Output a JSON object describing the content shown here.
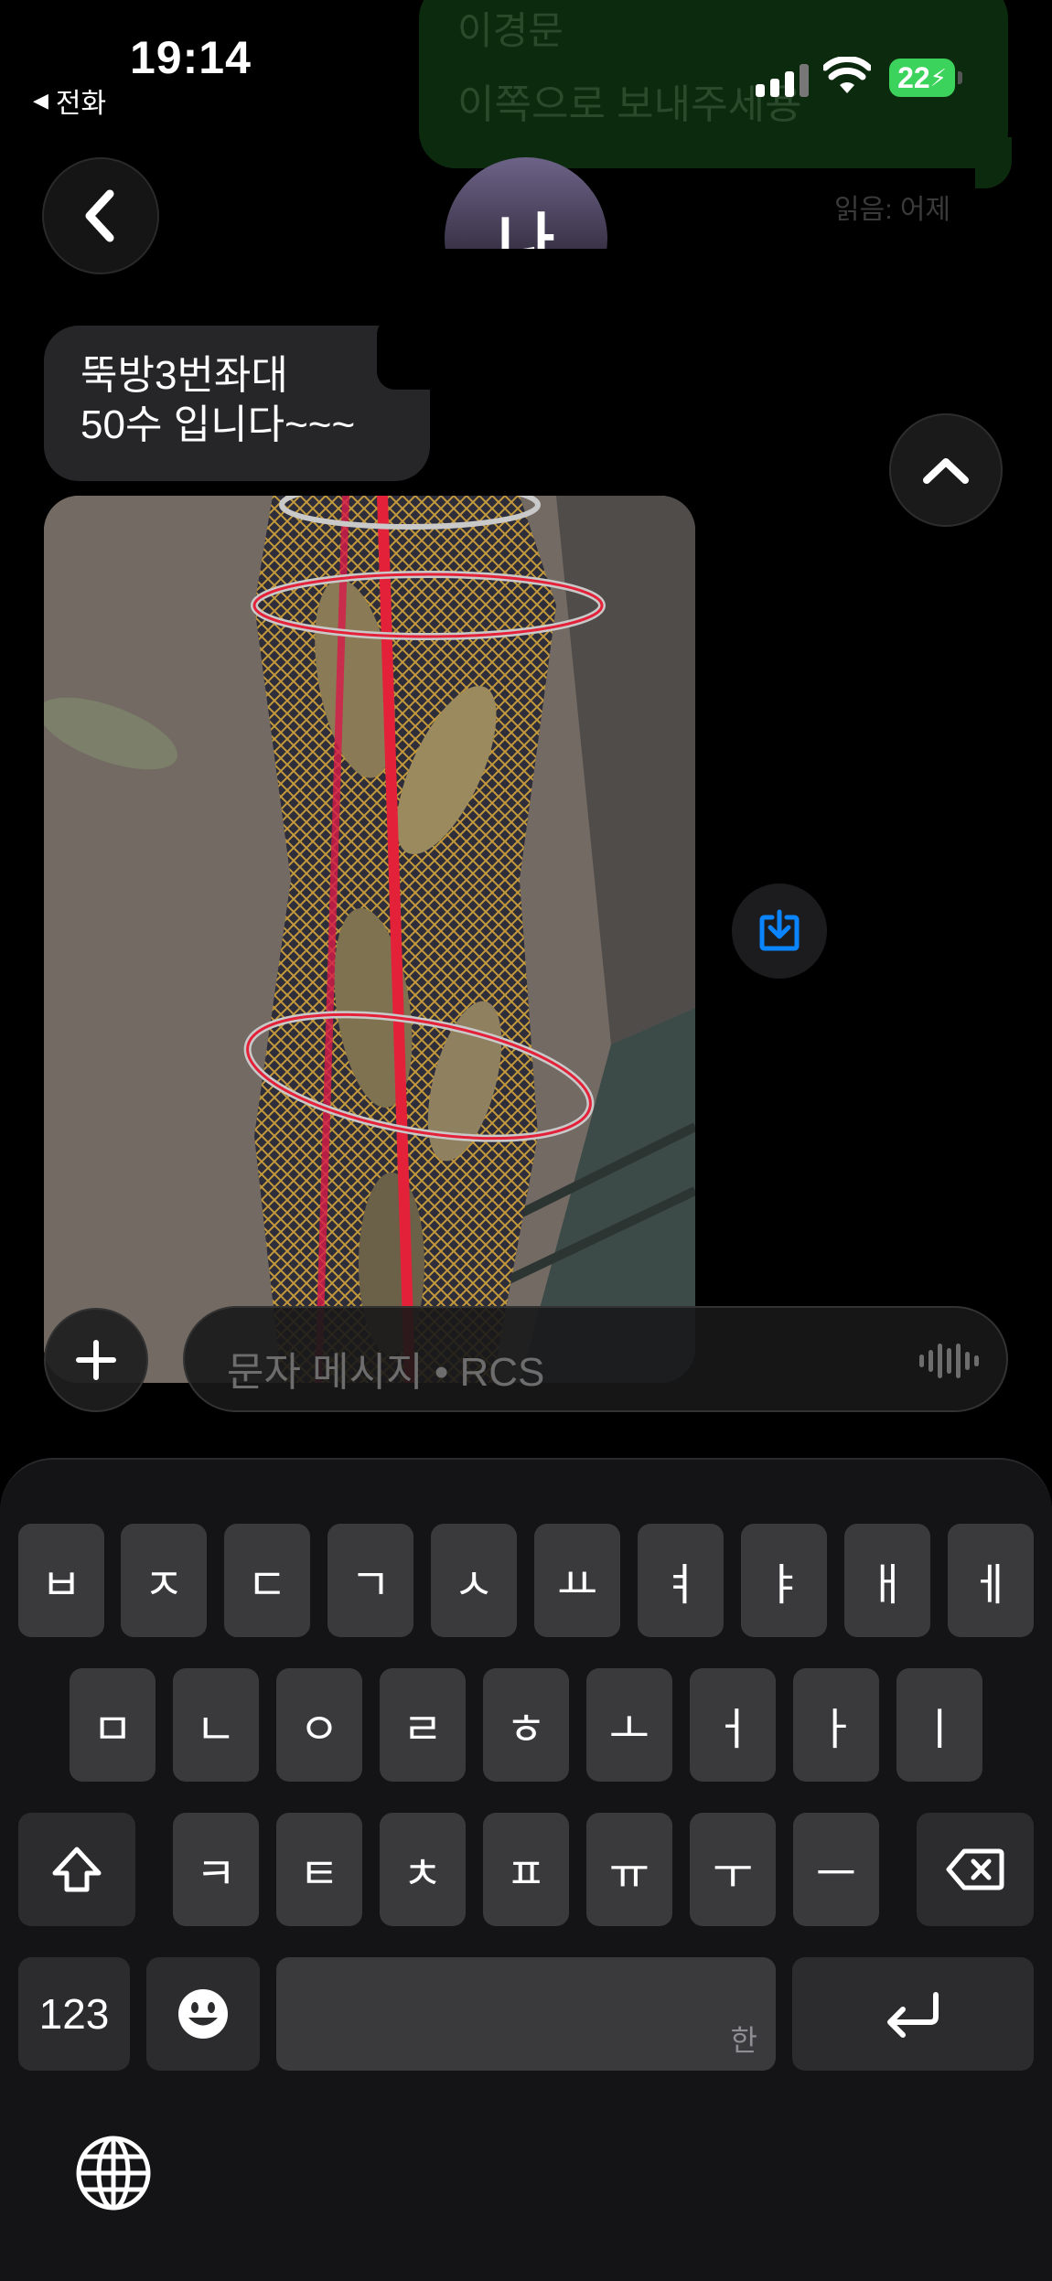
{
  "status_bar": {
    "time": "19:14",
    "back_app_label": "전화",
    "battery": "22"
  },
  "thread": {
    "top_bubble_line1": "이경문",
    "top_bubble_line2": "이쪽으로 보내주세용",
    "read_receipt": "읽음: 어제",
    "contact_avatar_text": "나",
    "received_lines": [
      "뚝방3번좌대",
      "50수 입니다~~~"
    ]
  },
  "input": {
    "placeholder": "문자 메시지 • RCS"
  },
  "keyboard": {
    "row1": [
      "ㅂ",
      "ㅈ",
      "ㄷ",
      "ㄱ",
      "ㅅ",
      "ㅛ",
      "ㅕ",
      "ㅑ",
      "ㅐ",
      "ㅔ"
    ],
    "row2": [
      "ㅁ",
      "ㄴ",
      "ㅇ",
      "ㄹ",
      "ㅎ",
      "ㅗ",
      "ㅓ",
      "ㅏ",
      "ㅣ"
    ],
    "row3": [
      "ㅋ",
      "ㅌ",
      "ㅊ",
      "ㅍ",
      "ㅠ",
      "ㅜ",
      "ㅡ"
    ],
    "numbers_key": "123",
    "space_sub_label": "한"
  },
  "icons": {
    "back": "chevron-left-icon",
    "scroll_up": "chevron-up-icon",
    "save": "save-download-icon",
    "add": "plus-icon",
    "mic": "waveform-icon",
    "shift": "shift-icon",
    "delete": "delete-backspace-icon",
    "emoji": "emoji-icon",
    "return": "return-icon",
    "globe": "globe-icon"
  },
  "colors": {
    "accent_blue": "#0a84ff",
    "battery_green": "#3bd35b",
    "bubble_gray": "#262628",
    "key_bg": "#3a3a3c"
  }
}
